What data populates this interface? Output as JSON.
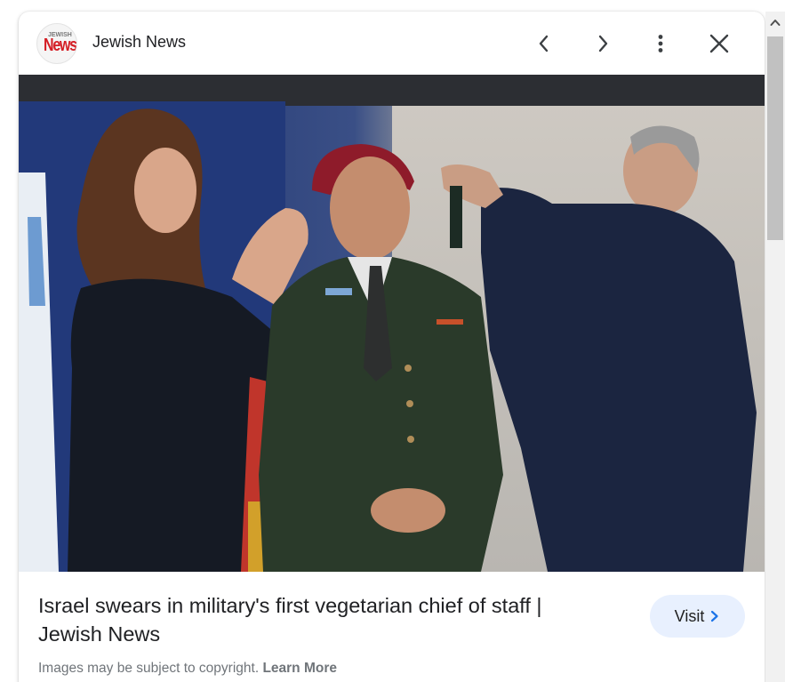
{
  "header": {
    "logo_top_text": "JEWISH",
    "logo_main_text": "News",
    "site_name": "Jewish News",
    "icons": {
      "prev": "chevron-left-icon",
      "next": "chevron-right-icon",
      "more": "more-vert-icon",
      "close": "close-icon"
    }
  },
  "image": {
    "lens_icon": "google-lens-icon"
  },
  "result": {
    "title": "Israel swears in military's first vegetarian chief of staff | Jewish News",
    "visit_label": "Visit",
    "visit_icon": "chevron-right-icon"
  },
  "footer": {
    "copyright_text": "Images may be subject to copyright.",
    "learn_more_label": "Learn More"
  },
  "colors": {
    "accent_button_bg": "#e8f0fe",
    "visit_chevron": "#1a73e8",
    "logo_red": "#d41d24",
    "text_primary": "#202124",
    "text_secondary": "#70757a"
  }
}
